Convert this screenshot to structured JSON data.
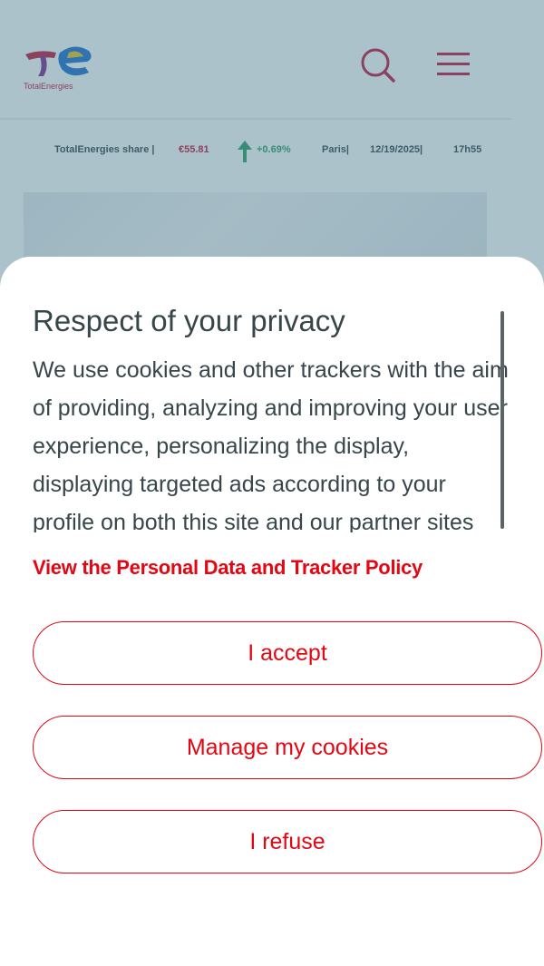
{
  "brand": {
    "name": "TotalEnergies",
    "accent": "#e30613"
  },
  "header": {
    "search_icon": "search-icon",
    "menu_icon": "hamburger-menu-icon"
  },
  "ticker": {
    "label": "TotalEnergies share |",
    "price": "€55.81",
    "change": "+0.69%",
    "market": "Paris|",
    "date": "12/19/2025|",
    "time": "17h55",
    "trend_icon": "arrow-up-icon"
  },
  "cookie_banner": {
    "title": "Respect of your privacy",
    "body": "We use cookies and other trackers with the aim of providing, analyzing and improving your user experience, personalizing the display, displaying targeted ads according to your profile on both this site and our partner sites and measuring their effectiveness.",
    "policy_link": "View the Personal Data and Tracker Policy",
    "accept_label": "I accept",
    "manage_label": "Manage my cookies",
    "refuse_label": "I refuse"
  }
}
